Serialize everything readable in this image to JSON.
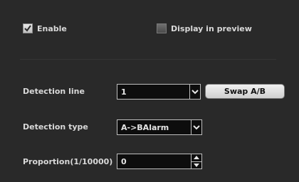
{
  "checkboxes": {
    "enable": {
      "label": "Enable",
      "checked": true
    },
    "display_in_preview": {
      "label": "Display in preview",
      "checked": false
    }
  },
  "detection_line": {
    "label": "Detection line",
    "value": "1",
    "swap_button": "Swap A/B"
  },
  "detection_type": {
    "label": "Detection type",
    "value": "A->BAlarm"
  },
  "proportion": {
    "label": "Proportion(1/10000)",
    "value": "0"
  },
  "icons": {
    "check": "checkmark-icon",
    "dropdown": "chevron-down-icon",
    "spin_up": "spin-up-icon",
    "spin_down": "spin-down-icon"
  }
}
